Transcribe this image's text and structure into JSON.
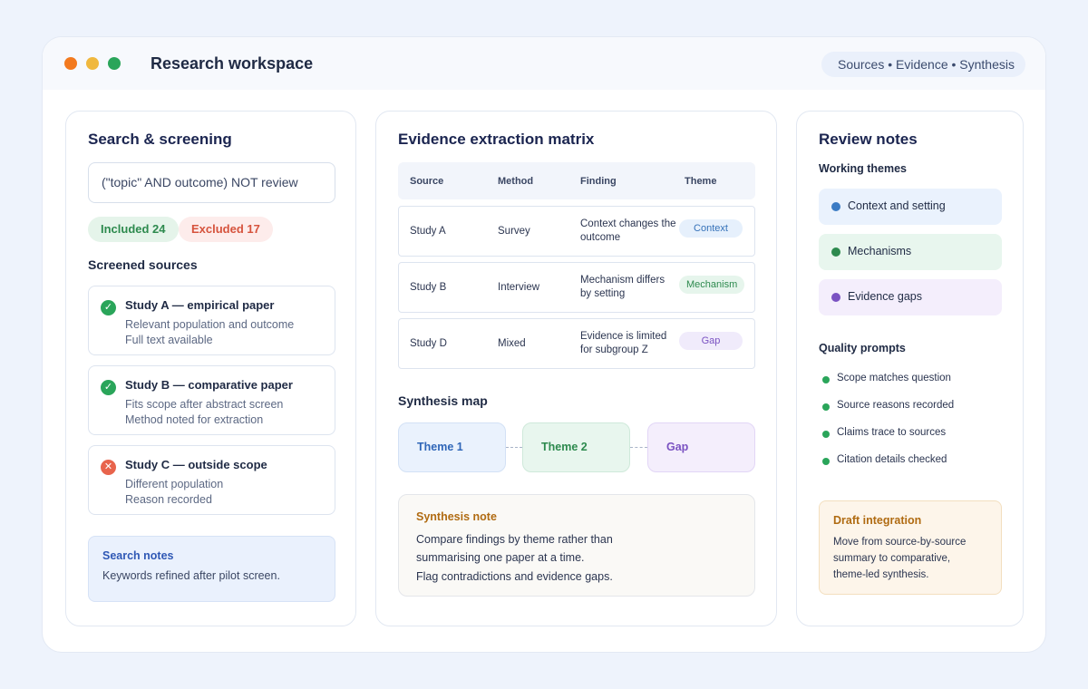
{
  "window": {
    "title": "Research workspace",
    "breadcrumb": "Sources • Evidence • Synthesis"
  },
  "colors": {
    "accent_blue": "#2f58b5",
    "included_green": "#2d8a4e",
    "excluded_red": "#d6533d",
    "gap_purple": "#7a52c2",
    "note_amber": "#b06b12"
  },
  "search": {
    "title": "Search & screening",
    "query": "(\"topic\" AND outcome) NOT review",
    "included_label": "Included 24",
    "excluded_label": "Excluded 17",
    "screened_title": "Screened sources",
    "sources": [
      {
        "icon": "check-circle-icon",
        "title": "Study A — empirical paper",
        "line1": "Relevant population and outcome",
        "line2": "Full text available"
      },
      {
        "icon": "check-circle-icon",
        "title": "Study B — comparative paper",
        "line1": "Fits scope after abstract screen",
        "line2": "Method noted for extraction"
      },
      {
        "icon": "x-circle-icon",
        "title": "Study C — outside scope",
        "line1": "Different population",
        "line2": "Reason recorded"
      }
    ],
    "notes_title": "Search notes",
    "notes_text": "Keywords refined after pilot screen."
  },
  "matrix": {
    "title": "Evidence extraction matrix",
    "headers": [
      "Source",
      "Method",
      "Finding",
      "Theme"
    ],
    "rows": [
      {
        "source": "Study A",
        "method": "Survey",
        "finding": "Context changes the outcome",
        "theme": "Context"
      },
      {
        "source": "Study B",
        "method": "Interview",
        "finding": "Mechanism differs by setting",
        "theme": "Mechanism"
      },
      {
        "source": "Study D",
        "method": "Mixed",
        "finding": "Evidence is limited for subgroup Z",
        "theme": "Gap"
      }
    ],
    "synthesis_title": "Synthesis map",
    "nodes": [
      "Theme 1",
      "Theme 2",
      "Gap"
    ],
    "note_title": "Synthesis note",
    "note_lines": [
      "Compare findings by theme rather than",
      "summarising one paper at a time.",
      "Flag contradictions and evidence gaps."
    ]
  },
  "review": {
    "title": "Review notes",
    "themes_title": "Working themes",
    "themes": [
      {
        "label": "Context and setting",
        "color": "#3a7bc4",
        "bg": "#eaf2fd"
      },
      {
        "label": "Mechanisms",
        "color": "#2d8a4e",
        "bg": "#e8f6ee"
      },
      {
        "label": "Evidence gaps",
        "color": "#7a52c2",
        "bg": "#f4eefc"
      }
    ],
    "quality_title": "Quality prompts",
    "prompts": [
      "Scope matches question",
      "Source reasons recorded",
      "Claims trace to sources",
      "Citation details checked"
    ],
    "draft_title": "Draft integration",
    "draft_lines": [
      "Move from source-by-source",
      "summary to comparative,",
      "theme-led synthesis."
    ]
  }
}
